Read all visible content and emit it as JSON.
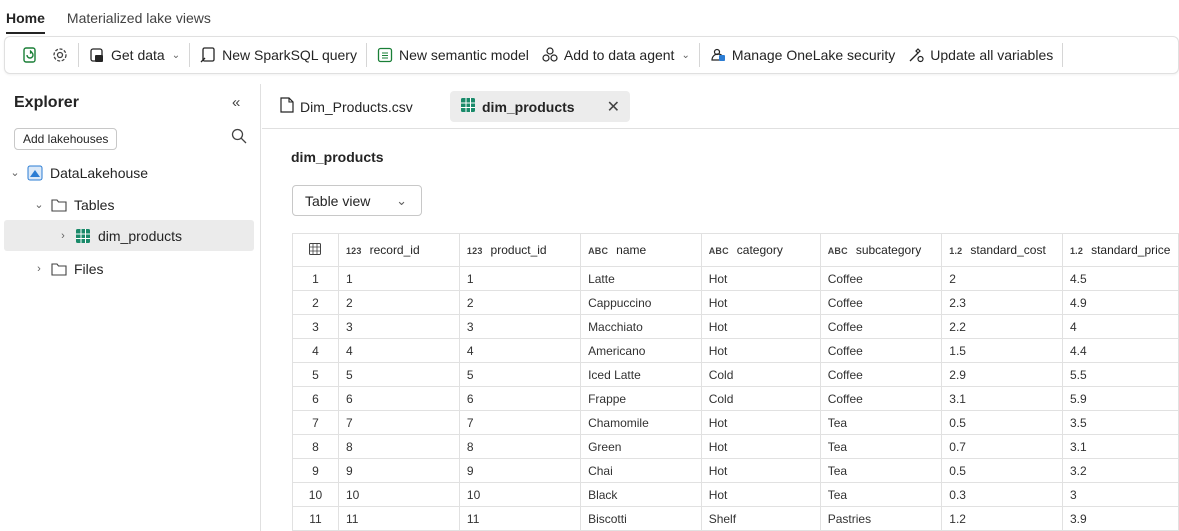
{
  "ribbon": {
    "tabs": [
      {
        "label": "Home",
        "active": true
      },
      {
        "label": "Materialized lake views",
        "active": false
      }
    ]
  },
  "toolbar": {
    "get_data": "Get data",
    "new_sparksql": "New SparkSQL query",
    "new_semantic_model": "New semantic model",
    "add_to_data_agent": "Add to data agent",
    "manage_security": "Manage OneLake security",
    "update_variables": "Update all variables"
  },
  "explorer": {
    "title": "Explorer",
    "add_lakehouses": "Add lakehouses",
    "tree": {
      "lakehouse": "DataLakehouse",
      "tables": "Tables",
      "table_item": "dim_products",
      "files": "Files"
    }
  },
  "doc_tabs": [
    {
      "label": "Dim_Products.csv",
      "active": false
    },
    {
      "label": "dim_products",
      "active": true
    }
  ],
  "main": {
    "table_title": "dim_products",
    "view_select": "Table view"
  },
  "grid": {
    "columns": [
      {
        "type": "123",
        "name": "record_id"
      },
      {
        "type": "123",
        "name": "product_id"
      },
      {
        "type": "ABC",
        "name": "name"
      },
      {
        "type": "ABC",
        "name": "category"
      },
      {
        "type": "ABC",
        "name": "subcategory"
      },
      {
        "type": "1.2",
        "name": "standard_cost"
      },
      {
        "type": "1.2",
        "name": "standard_price"
      }
    ],
    "rows": [
      [
        "1",
        "1",
        "1",
        "Latte",
        "Hot",
        "Coffee",
        "2",
        "4.5"
      ],
      [
        "2",
        "2",
        "2",
        "Cappuccino",
        "Hot",
        "Coffee",
        "2.3",
        "4.9"
      ],
      [
        "3",
        "3",
        "3",
        "Macchiato",
        "Hot",
        "Coffee",
        "2.2",
        "4"
      ],
      [
        "4",
        "4",
        "4",
        "Americano",
        "Hot",
        "Coffee",
        "1.5",
        "4.4"
      ],
      [
        "5",
        "5",
        "5",
        "Iced Latte",
        "Cold",
        "Coffee",
        "2.9",
        "5.5"
      ],
      [
        "6",
        "6",
        "6",
        "Frappe",
        "Cold",
        "Coffee",
        "3.1",
        "5.9"
      ],
      [
        "7",
        "7",
        "7",
        "Chamomile",
        "Hot",
        "Tea",
        "0.5",
        "3.5"
      ],
      [
        "8",
        "8",
        "8",
        "Green",
        "Hot",
        "Tea",
        "0.7",
        "3.1"
      ],
      [
        "9",
        "9",
        "9",
        "Chai",
        "Hot",
        "Tea",
        "0.5",
        "3.2"
      ],
      [
        "10",
        "10",
        "10",
        "Black",
        "Hot",
        "Tea",
        "0.3",
        "3"
      ],
      [
        "11",
        "11",
        "11",
        "Biscotti",
        "Shelf",
        "Pastries",
        "1.2",
        "3.9"
      ]
    ]
  },
  "colors": {
    "lakehouse_icon": "#2b7cd3",
    "table_icon": "#1a8a6a",
    "selected_bg": "#ebebeb"
  }
}
